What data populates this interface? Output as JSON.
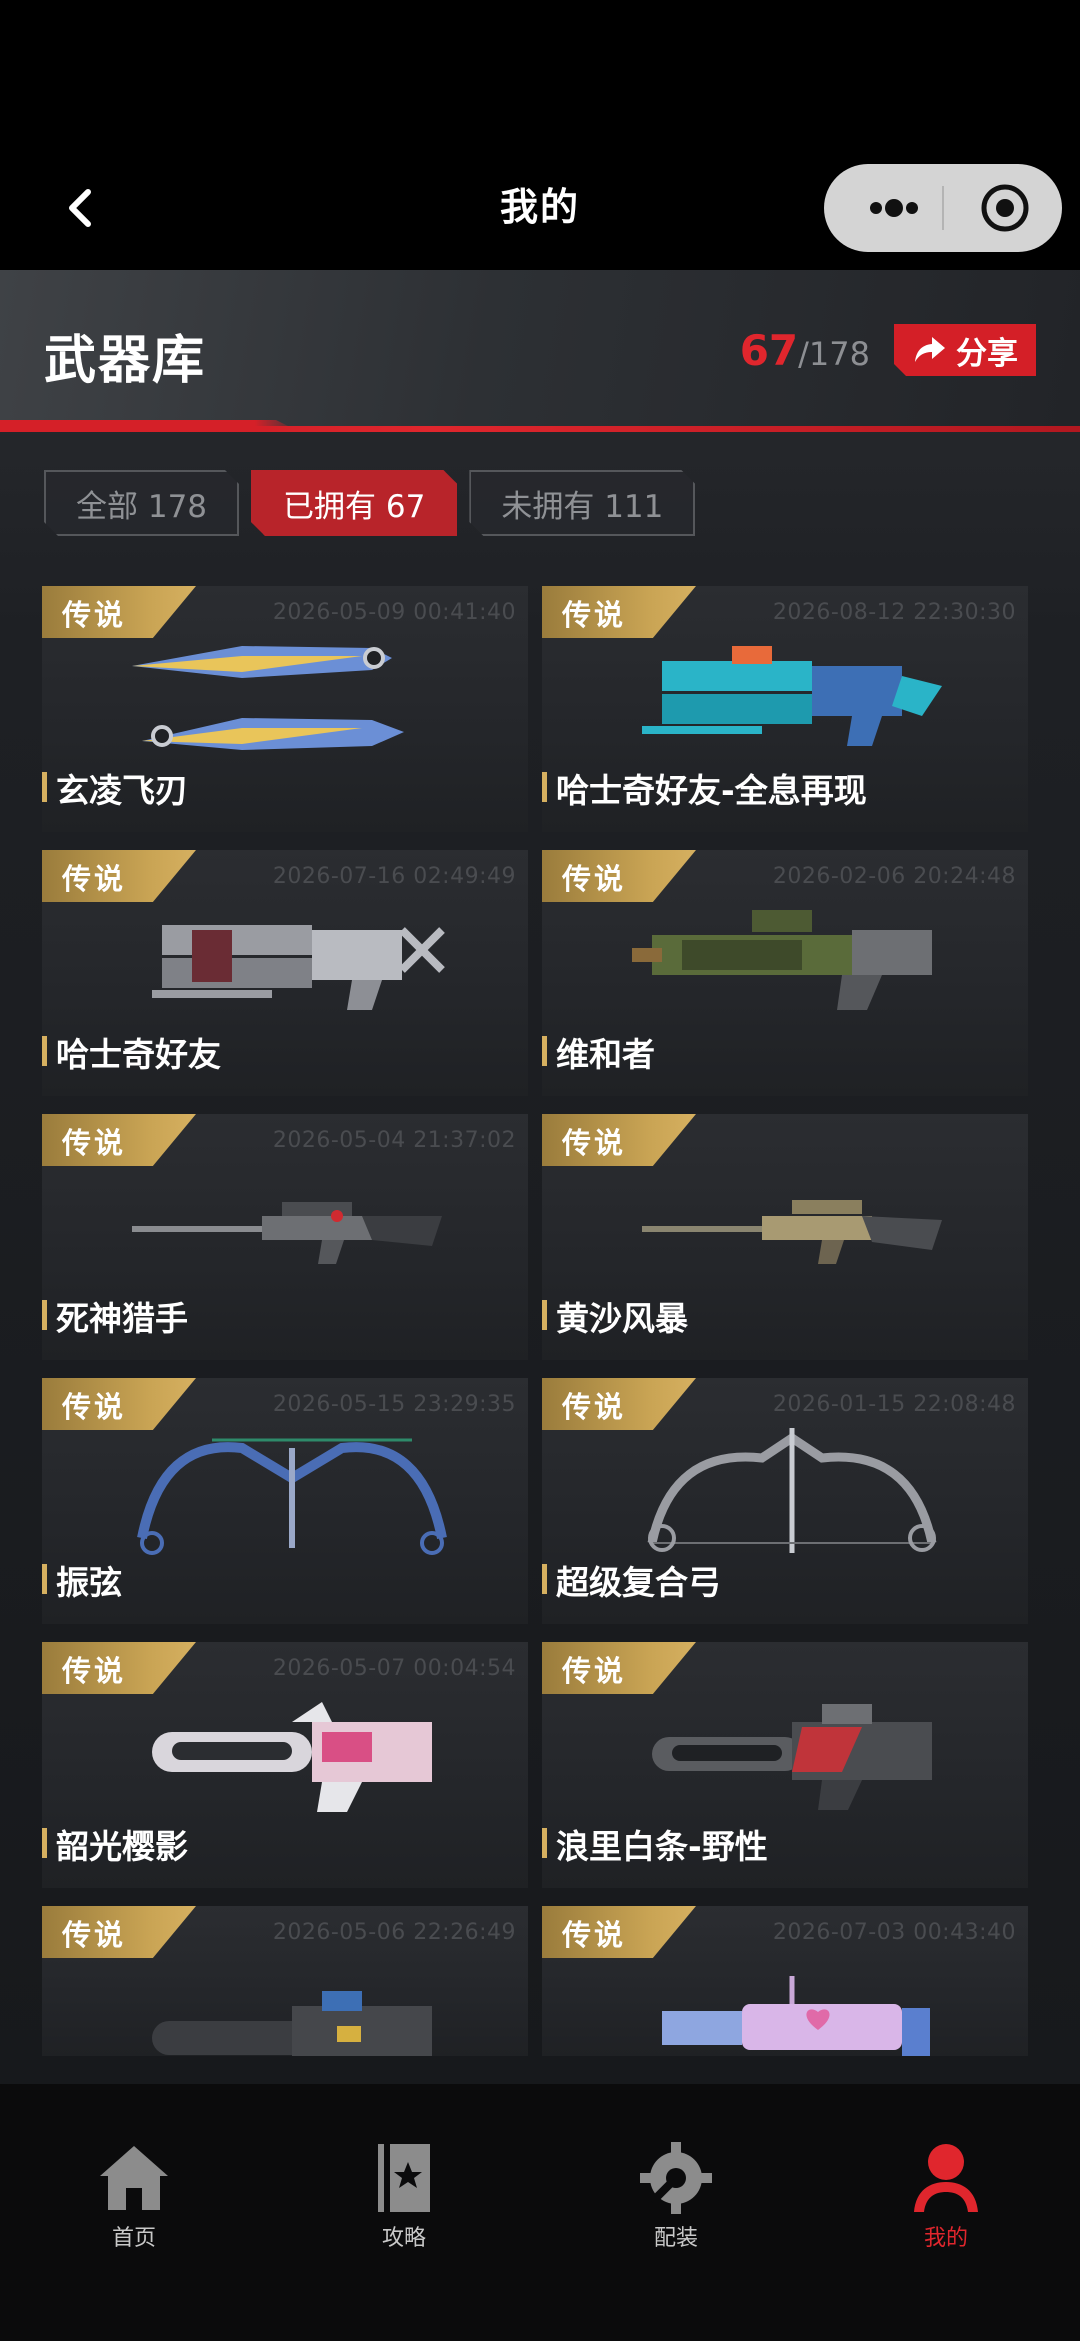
{
  "titlebar": {
    "title": "我的"
  },
  "header": {
    "section_title": "武器库",
    "owned_count": "67",
    "total_count": "178",
    "share_label": "分享"
  },
  "filters": [
    {
      "label": "全部 178",
      "active": false
    },
    {
      "label": "已拥有 67",
      "active": true
    },
    {
      "label": "未拥有 111",
      "active": false
    }
  ],
  "weapons": [
    {
      "rarity": "传说",
      "date": "2026-05-09 00:41:40",
      "name": "玄凌飞刃",
      "icon": "twin-blade-icon"
    },
    {
      "rarity": "传说",
      "date": "2026-08-12 22:30:30",
      "name": "哈士奇好友-全息再现",
      "icon": "cyan-launcher-icon"
    },
    {
      "rarity": "传说",
      "date": "2026-07-16 02:49:49",
      "name": "哈士奇好友",
      "icon": "silver-launcher-icon"
    },
    {
      "rarity": "传说",
      "date": "2026-02-06 20:24:48",
      "name": "维和者",
      "icon": "green-shotgun-icon"
    },
    {
      "rarity": "传说",
      "date": "2026-05-04 21:37:02",
      "name": "死神猎手",
      "icon": "sniper-rifle-icon"
    },
    {
      "rarity": "传说",
      "date": "",
      "name": "黄沙风暴",
      "icon": "desert-sniper-icon"
    },
    {
      "rarity": "传说",
      "date": "2026-05-15 23:29:35",
      "name": "振弦",
      "icon": "blue-bow-icon"
    },
    {
      "rarity": "传说",
      "date": "2026-01-15 22:08:48",
      "name": "超级复合弓",
      "icon": "compound-bow-icon"
    },
    {
      "rarity": "传说",
      "date": "2026-05-07 00:04:54",
      "name": "韶光樱影",
      "icon": "pink-rifle-icon"
    },
    {
      "rarity": "传说",
      "date": "",
      "name": "浪里白条-野性",
      "icon": "red-rifle-icon"
    },
    {
      "rarity": "传说",
      "date": "2026-05-06 22:26:49",
      "name": "",
      "icon": "dark-rifle-icon"
    },
    {
      "rarity": "传说",
      "date": "2026-07-03 00:43:40",
      "name": "",
      "icon": "pastel-smg-icon"
    }
  ],
  "bottom_nav": [
    {
      "label": "首页",
      "icon": "home-icon",
      "active": false
    },
    {
      "label": "攻略",
      "icon": "guide-book-icon",
      "active": false
    },
    {
      "label": "配装",
      "icon": "wrench-gear-icon",
      "active": false
    },
    {
      "label": "我的",
      "icon": "user-icon",
      "active": true
    }
  ],
  "colors": {
    "accent_red": "#e0262d",
    "legend_gold": "#c9a454"
  }
}
